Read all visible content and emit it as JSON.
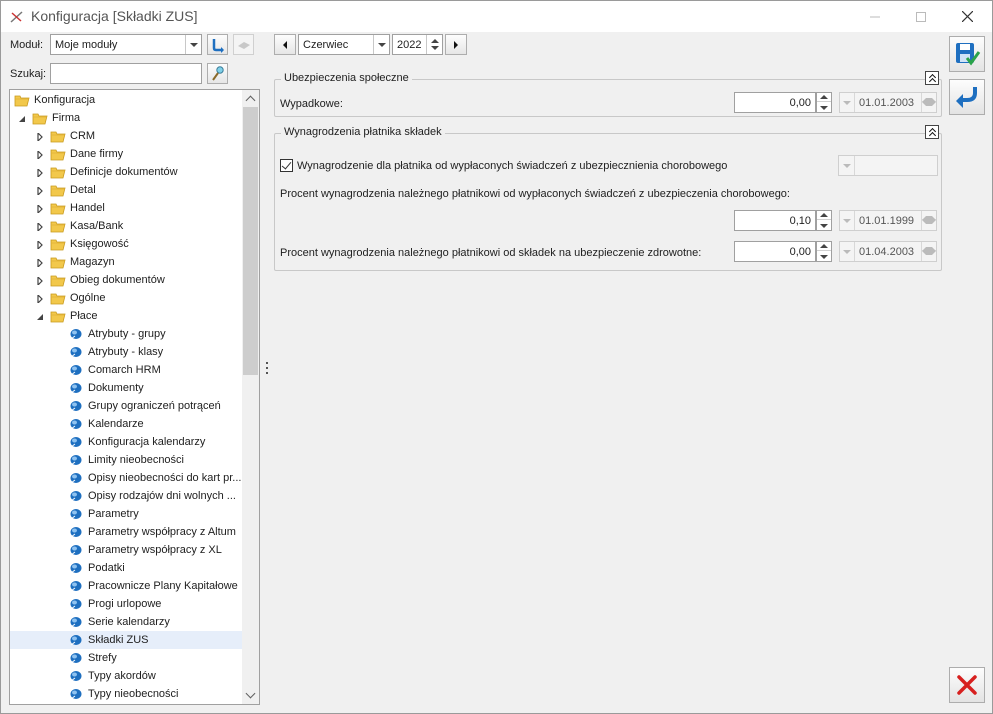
{
  "window": {
    "title": "Konfiguracja [Składki ZUS]"
  },
  "toolbar": {
    "module_label": "Moduł:",
    "module_value": "Moje moduły",
    "search_label": "Szukaj:",
    "search_value": ""
  },
  "period": {
    "month": "Czerwiec",
    "year": "2022"
  },
  "tree": {
    "root": "Konfiguracja",
    "firma": "Firma",
    "firma_children": [
      "CRM",
      "Dane firmy",
      "Definicje dokumentów",
      "Detal",
      "Handel",
      "Kasa/Bank",
      "Księgowość",
      "Magazyn",
      "Obieg dokumentów",
      "Ogólne"
    ],
    "place": "Płace",
    "place_children": [
      "Atrybuty - grupy",
      "Atrybuty - klasy",
      "Comarch HRM",
      "Dokumenty",
      "Grupy ograniczeń potrąceń",
      "Kalendarze",
      "Konfiguracja kalendarzy",
      "Limity nieobecności",
      "Opisy nieobecności do kart pr...",
      "Opisy rodzajów dni wolnych ...",
      "Parametry",
      "Parametry współpracy z Altum",
      "Parametry współpracy z XL",
      "Podatki",
      "Pracownicze Plany Kapitałowe",
      "Progi urlopowe",
      "Serie kalendarzy",
      "Składki ZUS",
      "Strefy",
      "Typy akordów",
      "Typy nieobecności"
    ],
    "selected": "Składki ZUS"
  },
  "social": {
    "group_title": "Ubezpieczenia społeczne",
    "wypadkowe_label": "Wypadkowe:",
    "wypadkowe_value": "0,00",
    "wypadkowe_date": "01.01.2003"
  },
  "payer": {
    "group_title": "Wynagrodzenia płatnika składek",
    "checkbox_label": "Wynagrodzenie dla płatnika od wypłaconych świadczeń z ubezpiecznienia chorobowego",
    "checkbox_checked": true,
    "sickness_label": "Procent wynagrodzenia należnego płatnikowi od wypłaconych świadczeń z ubezpieczenia chorobowego:",
    "sickness_value": "0,10",
    "sickness_date": "01.01.1999",
    "health_label": "Procent wynagrodzenia należnego płatnikowi od składek na ubezpieczenie zdrowotne:",
    "health_value": "0,00",
    "health_date": "01.04.2003"
  },
  "colors": {
    "selection": "#e6eefa",
    "folder": "#f2c84b",
    "accent_blue": "#1e6fc0",
    "close_red": "#d7201f"
  }
}
